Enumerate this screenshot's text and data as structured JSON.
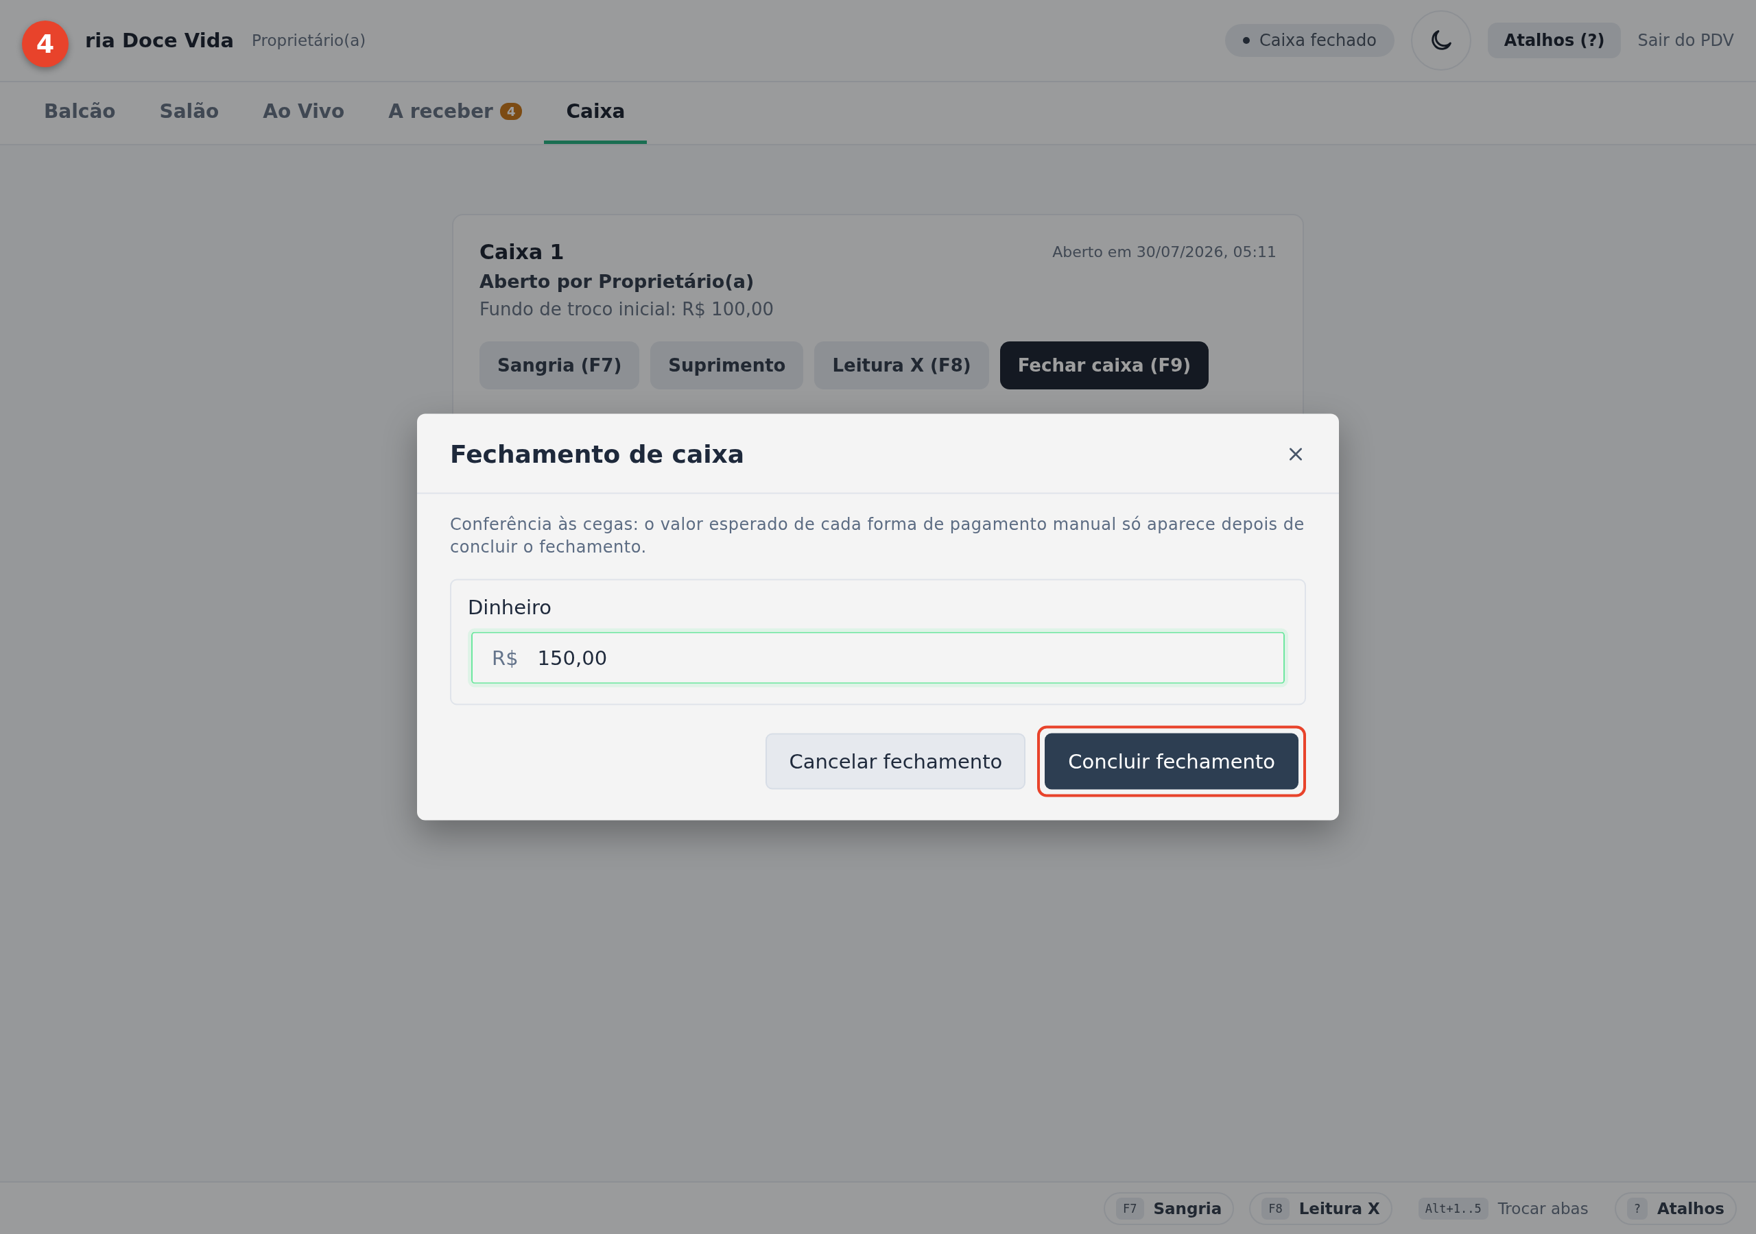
{
  "annotation": {
    "step": "4"
  },
  "header": {
    "brand": "ria Doce Vida",
    "role": "Proprietário(a)",
    "status": "Caixa fechado",
    "shortcuts_button": "Atalhos (?)",
    "exit_link": "Sair do PDV"
  },
  "tabs": [
    {
      "label": "Balcão",
      "selected": false
    },
    {
      "label": "Salão",
      "selected": false
    },
    {
      "label": "Ao Vivo",
      "selected": false
    },
    {
      "label": "A receber",
      "selected": false,
      "badge": "4"
    },
    {
      "label": "Caixa",
      "selected": true
    }
  ],
  "register_card": {
    "title": "Caixa 1",
    "opened_at": "Aberto em 30/07/2026, 05:11",
    "opened_by": "Aberto por Proprietário(a)",
    "initial_change": "Fundo de troco inicial: R$ 100,00",
    "actions": [
      {
        "label": "Sangria (F7)",
        "kind": "secondary"
      },
      {
        "label": "Suprimento",
        "kind": "secondary"
      },
      {
        "label": "Leitura X (F8)",
        "kind": "secondary"
      },
      {
        "label": "Fechar caixa (F9)",
        "kind": "primary"
      }
    ]
  },
  "modal": {
    "title": "Fechamento de caixa",
    "note": "Conferência às cegas: o valor esperado de cada forma de pagamento manual só aparece depois de concluir o fechamento.",
    "fields": [
      {
        "label": "Dinheiro",
        "prefix": "R$",
        "value": "150,00",
        "focused": true
      }
    ],
    "buttons": [
      {
        "label": "Cancelar fechamento",
        "kind": "secondary",
        "highlighted": false
      },
      {
        "label": "Concluir fechamento",
        "kind": "primary",
        "highlighted": true
      }
    ]
  },
  "footer_hints": [
    {
      "key": "F7",
      "label": "Sangria",
      "kind": "chip"
    },
    {
      "key": "F8",
      "label": "Leitura X",
      "kind": "chip"
    },
    {
      "key": "Alt+1..5",
      "label": "Trocar abas",
      "kind": "plain"
    },
    {
      "key": "?",
      "label": "Atalhos",
      "kind": "chip"
    }
  ]
}
